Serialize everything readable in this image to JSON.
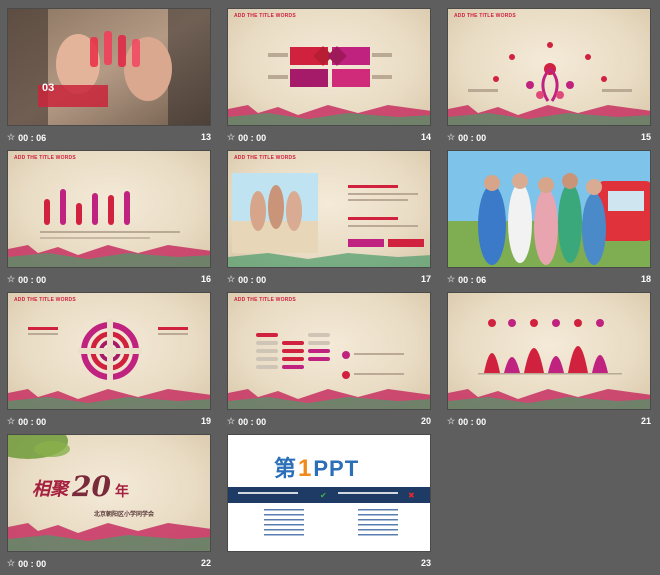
{
  "slides": [
    {
      "number": "13",
      "timer": "00 : 06",
      "big_label": "03"
    },
    {
      "number": "14",
      "timer": "00 : 00",
      "heading": "ADD THE TITLE WORDS"
    },
    {
      "number": "15",
      "timer": "00 : 00",
      "heading": "ADD THE TITLE WORDS"
    },
    {
      "number": "16",
      "timer": "00 : 00",
      "heading": "ADD THE TITLE WORDS"
    },
    {
      "number": "17",
      "timer": "00 : 00",
      "heading": "ADD THE TITLE WORDS"
    },
    {
      "number": "18",
      "timer": "00 : 06"
    },
    {
      "number": "19",
      "timer": "00 : 00",
      "heading": "ADD THE TITLE WORDS"
    },
    {
      "number": "20",
      "timer": "00 : 00",
      "heading": "ADD THE TITLE WORDS"
    },
    {
      "number": "21",
      "timer": "00 : 00"
    },
    {
      "number": "22",
      "timer": "00 : 00",
      "title_cn": "相聚",
      "title_num": "20",
      "title_year": "年",
      "subtitle": "北京朝阳区小学同学会"
    },
    {
      "number": "23",
      "timer": "",
      "brand_first": "第",
      "brand_one": "1",
      "brand_ppt": "PPT"
    }
  ],
  "colors": {
    "accent": "#d0213e",
    "magenta": "#c0227f",
    "background": "#5e5e5e",
    "banner": "#1e3b66"
  }
}
